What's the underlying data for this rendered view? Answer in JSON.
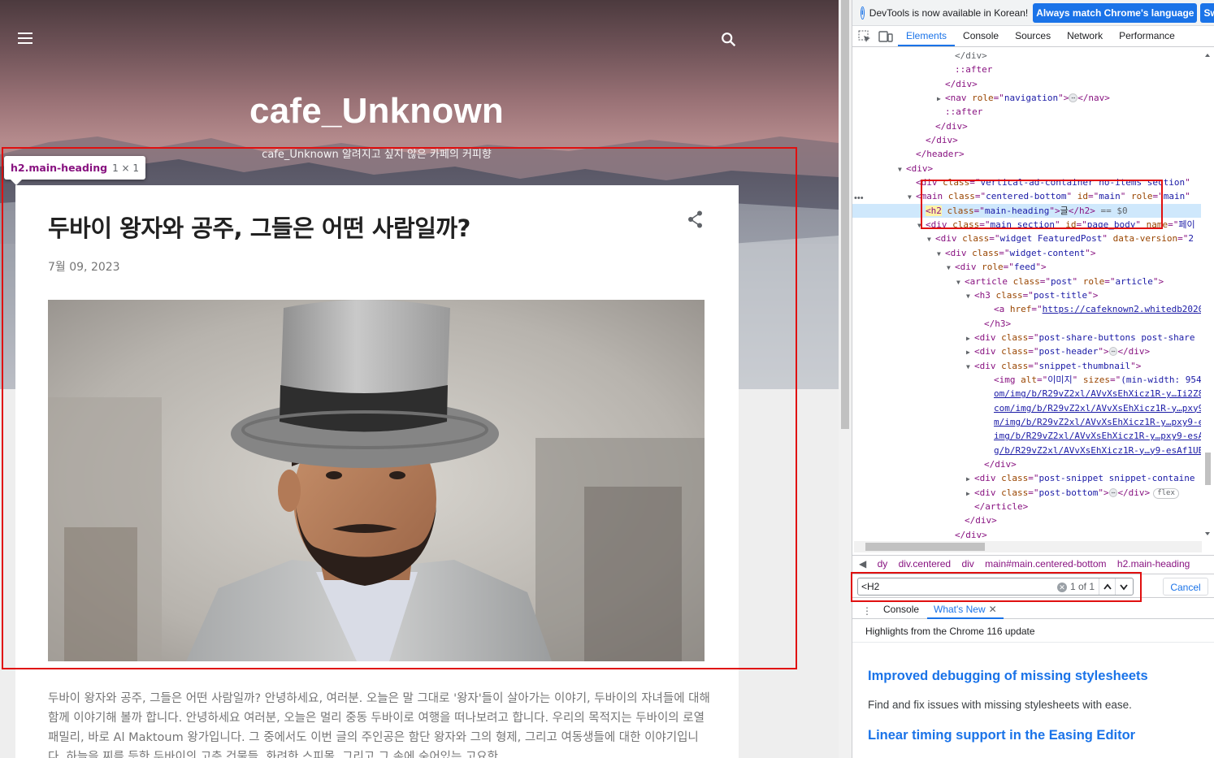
{
  "page": {
    "blog_title": "cafe_Unknown",
    "blog_description": "cafe_Unknown 알려지고 싶지 않은 카페의 커피향",
    "post": {
      "title": "두바이 왕자와 공주, 그들은 어떤 사람일까?",
      "date": "7월 09, 2023",
      "body": "두바이 왕자와 공주, 그들은 어떤 사람일까? 안녕하세요, 여러분. 오늘은 말 그대로 '왕자'들이 살아가는 이야기, 두바이의 자녀들에 대해 함께 이야기해 볼까 합니다. 안녕하세요 여러분, 오늘은 멀리 중동 두바이로 여행을 떠나보려고 합니다. 우리의 목적지는 두바이의 로열 패밀리, 바로 Al Maktoum 왕가입니다. 그 중에서도 이번 글의 주인공은 함단 왕자와 그의 형제, 그리고 여동생들에 대한 이야기입니다. 하늘을 찌를 듯한 두바이의 고층 건물들, 화려한 스피몰, 그리고 그 속에 숨어있는 고요한"
    },
    "inspect_tooltip": {
      "selector": "h2.main-heading",
      "size": "1 × 1"
    }
  },
  "devtools": {
    "infobar": {
      "text": "DevTools is now available in Korean!",
      "button1": "Always match Chrome's language",
      "button2": "Swi"
    },
    "tabs": [
      "Elements",
      "Console",
      "Sources",
      "Network",
      "Performance"
    ],
    "active_tab": "Elements",
    "breadcrumbs": [
      "dy",
      "div.centered",
      "div",
      "main#main.centered-bottom",
      "h2.main-heading"
    ],
    "search": {
      "value": "<H2",
      "count": "1 of 1",
      "cancel": "Cancel"
    },
    "drawer": {
      "tabs": [
        "Console",
        "What's New"
      ],
      "subtitle": "Highlights from the Chrome 116 update",
      "items": [
        {
          "title": "Improved debugging of missing stylesheets",
          "desc": "Find and fix issues with missing stylesheets with ease."
        },
        {
          "title": "Linear timing support in the Easing Editor",
          "desc": ""
        }
      ]
    },
    "dom_lines": [
      {
        "indent": 10,
        "tri": "",
        "segments": [
          [
            "gr",
            "</div>"
          ]
        ]
      },
      {
        "indent": 10,
        "tri": "",
        "segments": [
          [
            "ps",
            "::after"
          ]
        ]
      },
      {
        "indent": 9,
        "tri": "",
        "segments": [
          [
            "tg",
            "</div>"
          ]
        ]
      },
      {
        "indent": 9,
        "tri": "▶",
        "segments": [
          [
            "tg",
            "<nav "
          ],
          [
            "an",
            "role"
          ],
          [
            "tg",
            "=\""
          ],
          [
            "av",
            "navigation"
          ],
          [
            "tg",
            "\">"
          ],
          [
            "dots",
            "⋯"
          ],
          [
            "tg",
            "</nav>"
          ]
        ]
      },
      {
        "indent": 9,
        "tri": "",
        "segments": [
          [
            "ps",
            "::after"
          ]
        ]
      },
      {
        "indent": 8,
        "tri": "",
        "segments": [
          [
            "tg",
            "</div>"
          ]
        ]
      },
      {
        "indent": 7,
        "tri": "",
        "segments": [
          [
            "tg",
            "</div>"
          ]
        ]
      },
      {
        "indent": 6,
        "tri": "",
        "segments": [
          [
            "tg",
            "</header>"
          ]
        ]
      },
      {
        "indent": 5,
        "tri": "▼",
        "segments": [
          [
            "tg",
            "<div>"
          ]
        ]
      },
      {
        "indent": 6,
        "tri": "",
        "segments": [
          [
            "tg",
            "<div "
          ],
          [
            "an",
            "class"
          ],
          [
            "tg",
            "=\""
          ],
          [
            "av",
            "vertical-ad-container no-items section"
          ],
          [
            "tg",
            "\""
          ]
        ]
      },
      {
        "indent": 6,
        "tri": "▼",
        "segments": [
          [
            "tg",
            "<main "
          ],
          [
            "an",
            "class"
          ],
          [
            "tg",
            "=\""
          ],
          [
            "av",
            "centered-bottom"
          ],
          [
            "tg",
            "\" "
          ],
          [
            "an",
            "id"
          ],
          [
            "tg",
            "=\""
          ],
          [
            "av",
            "main"
          ],
          [
            "tg",
            "\" "
          ],
          [
            "an",
            "role"
          ],
          [
            "tg",
            "=\""
          ],
          [
            "av",
            "main"
          ],
          [
            "tg",
            "\""
          ]
        ]
      },
      {
        "indent": 7,
        "tri": "",
        "sel": true,
        "segments": [
          [
            "hl",
            "<h2"
          ],
          [
            "tg",
            " "
          ],
          [
            "an",
            "class"
          ],
          [
            "tg",
            "=\""
          ],
          [
            "av",
            "main-heading"
          ],
          [
            "tg",
            "\">"
          ],
          [
            "tx",
            "글"
          ],
          [
            "tg",
            "</h2>"
          ],
          [
            "gr",
            " == $0"
          ]
        ]
      },
      {
        "indent": 7,
        "tri": "▼",
        "segments": [
          [
            "tg",
            "<div "
          ],
          [
            "an",
            "class"
          ],
          [
            "tg",
            "=\""
          ],
          [
            "av",
            "main section"
          ],
          [
            "tg",
            "\" "
          ],
          [
            "an",
            "id"
          ],
          [
            "tg",
            "=\""
          ],
          [
            "av",
            "page_body"
          ],
          [
            "tg",
            "\" "
          ],
          [
            "an",
            "name"
          ],
          [
            "tg",
            "=\""
          ],
          [
            "av",
            "페이"
          ]
        ]
      },
      {
        "indent": 8,
        "tri": "▼",
        "segments": [
          [
            "tg",
            "<div "
          ],
          [
            "an",
            "class"
          ],
          [
            "tg",
            "=\""
          ],
          [
            "av",
            "widget FeaturedPost"
          ],
          [
            "tg",
            "\" "
          ],
          [
            "an",
            "data-version"
          ],
          [
            "tg",
            "=\""
          ],
          [
            "av",
            "2"
          ]
        ]
      },
      {
        "indent": 9,
        "tri": "▼",
        "segments": [
          [
            "tg",
            "<div "
          ],
          [
            "an",
            "class"
          ],
          [
            "tg",
            "=\""
          ],
          [
            "av",
            "widget-content"
          ],
          [
            "tg",
            "\">"
          ]
        ]
      },
      {
        "indent": 10,
        "tri": "▼",
        "segments": [
          [
            "tg",
            "<div "
          ],
          [
            "an",
            "role"
          ],
          [
            "tg",
            "=\""
          ],
          [
            "av",
            "feed"
          ],
          [
            "tg",
            "\">"
          ]
        ]
      },
      {
        "indent": 11,
        "tri": "▼",
        "segments": [
          [
            "tg",
            "<article "
          ],
          [
            "an",
            "class"
          ],
          [
            "tg",
            "=\""
          ],
          [
            "av",
            "post"
          ],
          [
            "tg",
            "\" "
          ],
          [
            "an",
            "role"
          ],
          [
            "tg",
            "=\""
          ],
          [
            "av",
            "article"
          ],
          [
            "tg",
            "\">"
          ]
        ]
      },
      {
        "indent": 12,
        "tri": "▼",
        "segments": [
          [
            "tg",
            "<h3 "
          ],
          [
            "an",
            "class"
          ],
          [
            "tg",
            "=\""
          ],
          [
            "av",
            "post-title"
          ],
          [
            "tg",
            "\">"
          ]
        ]
      },
      {
        "indent": 14,
        "tri": "",
        "segments": [
          [
            "tg",
            "<a "
          ],
          [
            "an",
            "href"
          ],
          [
            "tg",
            "=\""
          ],
          [
            "lk",
            "https://cafeknown2.whitedb2020"
          ]
        ]
      },
      {
        "indent": 13,
        "tri": "",
        "segments": [
          [
            "tg",
            "</h3>"
          ]
        ]
      },
      {
        "indent": 12,
        "tri": "▶",
        "segments": [
          [
            "tg",
            "<div "
          ],
          [
            "an",
            "class"
          ],
          [
            "tg",
            "=\""
          ],
          [
            "av",
            "post-share-buttons post-share"
          ]
        ]
      },
      {
        "indent": 12,
        "tri": "▶",
        "segments": [
          [
            "tg",
            "<div "
          ],
          [
            "an",
            "class"
          ],
          [
            "tg",
            "=\""
          ],
          [
            "av",
            "post-header"
          ],
          [
            "tg",
            "\">"
          ],
          [
            "dots",
            "⋯"
          ],
          [
            "tg",
            "</div>"
          ]
        ]
      },
      {
        "indent": 12,
        "tri": "▼",
        "segments": [
          [
            "tg",
            "<div "
          ],
          [
            "an",
            "class"
          ],
          [
            "tg",
            "=\""
          ],
          [
            "av",
            "snippet-thumbnail"
          ],
          [
            "tg",
            "\">"
          ]
        ]
      },
      {
        "indent": 14,
        "tri": "",
        "segments": [
          [
            "tg",
            "<img "
          ],
          [
            "an",
            "alt"
          ],
          [
            "tg",
            "=\""
          ],
          [
            "av",
            "이미지"
          ],
          [
            "tg",
            "\" "
          ],
          [
            "an",
            "sizes"
          ],
          [
            "tg",
            "=\""
          ],
          [
            "av",
            "(min-width: 954"
          ]
        ]
      },
      {
        "indent": 14,
        "tri": "",
        "segments": [
          [
            "lk",
            "om/img/b/R29vZ2xl/AVvXsEhXicz1R-y…Ii2Z8"
          ]
        ]
      },
      {
        "indent": 14,
        "tri": "",
        "segments": [
          [
            "lk",
            "com/img/b/R29vZ2xl/AVvXsEhXicz1R-y…pxy9"
          ]
        ]
      },
      {
        "indent": 14,
        "tri": "",
        "segments": [
          [
            "lk",
            "m/img/b/R29vZ2xl/AVvXsEhXicz1R-y…pxy9-e"
          ]
        ]
      },
      {
        "indent": 14,
        "tri": "",
        "segments": [
          [
            "lk",
            "img/b/R29vZ2xl/AVvXsEhXicz1R-y…pxy9-esA"
          ]
        ]
      },
      {
        "indent": 14,
        "tri": "",
        "segments": [
          [
            "lk",
            "g/b/R29vZ2xl/AVvXsEhXicz1R-y…y9-esAf1UB"
          ]
        ]
      },
      {
        "indent": 13,
        "tri": "",
        "segments": [
          [
            "tg",
            "</div>"
          ]
        ]
      },
      {
        "indent": 12,
        "tri": "▶",
        "segments": [
          [
            "tg",
            "<div "
          ],
          [
            "an",
            "class"
          ],
          [
            "tg",
            "=\""
          ],
          [
            "av",
            "post-snippet snippet-containe"
          ]
        ]
      },
      {
        "indent": 12,
        "tri": "▶",
        "segments": [
          [
            "tg",
            "<div "
          ],
          [
            "an",
            "class"
          ],
          [
            "tg",
            "=\""
          ],
          [
            "av",
            "post-bottom"
          ],
          [
            "tg",
            "\">"
          ],
          [
            "dots",
            "⋯"
          ],
          [
            "tg",
            "</div>"
          ],
          [
            "flex",
            "flex"
          ]
        ]
      },
      {
        "indent": 12,
        "tri": "",
        "segments": [
          [
            "tg",
            "</article>"
          ]
        ]
      },
      {
        "indent": 11,
        "tri": "",
        "segments": [
          [
            "tg",
            "</div>"
          ]
        ]
      },
      {
        "indent": 10,
        "tri": "",
        "segments": [
          [
            "tg",
            "</div>"
          ]
        ]
      },
      {
        "indent": 9,
        "tri": "",
        "segments": [
          [
            "tg",
            "</div>"
          ]
        ]
      }
    ]
  }
}
